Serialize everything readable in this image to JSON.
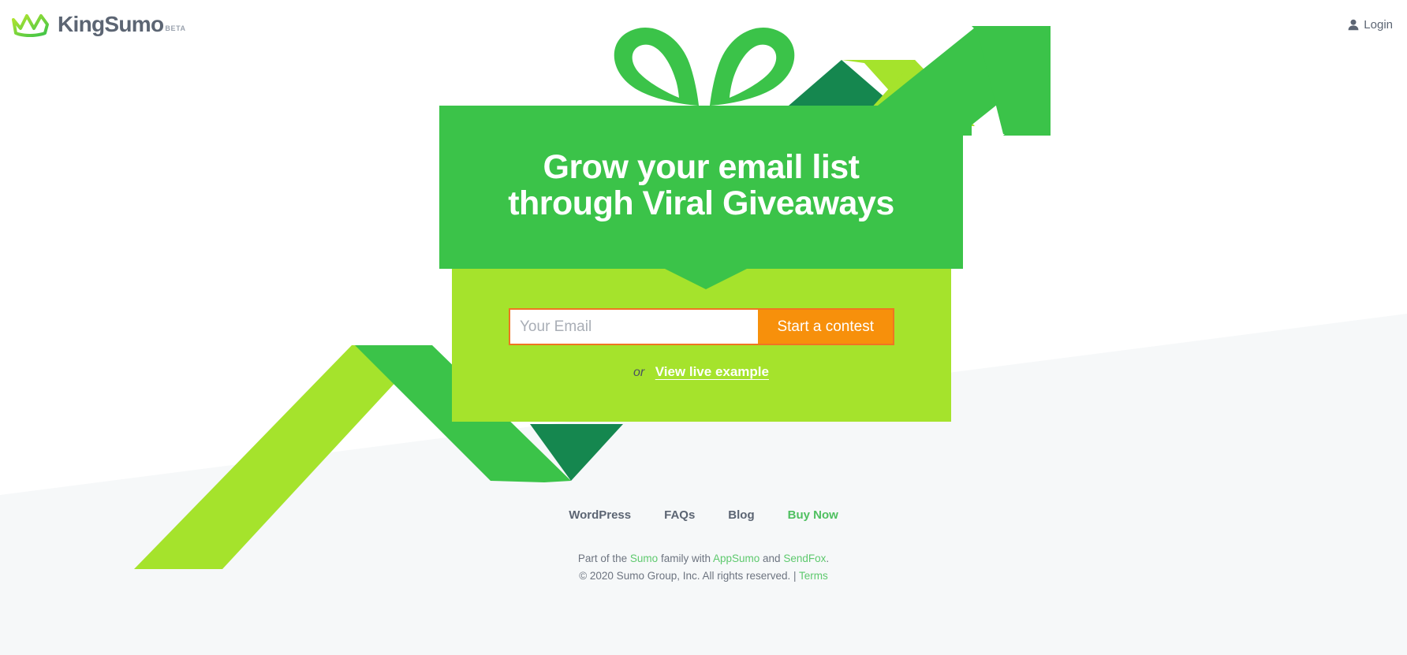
{
  "brand": {
    "name_king": "King",
    "name_sumo": "Sumo",
    "badge": "BETA",
    "crown_icon": "crown-icon",
    "crown_color_light": "#a5e32c",
    "crown_color_dark": "#3bc349"
  },
  "header": {
    "login_label": "Login",
    "login_icon": "user-icon"
  },
  "hero": {
    "headline_line1": "Grow your email list",
    "headline_line2": "through Viral Giveaways",
    "panel_color": "#3bc349",
    "panel_lime_color": "#a5e32c"
  },
  "form": {
    "email_placeholder": "Your Email",
    "email_value": "",
    "submit_label": "Start a contest",
    "submit_color": "#f7900b",
    "border_color": "#ef7522",
    "or_label": "or",
    "example_link_label": "View live example"
  },
  "footer": {
    "nav": [
      {
        "label": "WordPress",
        "accent": false
      },
      {
        "label": "FAQs",
        "accent": false
      },
      {
        "label": "Blog",
        "accent": false
      },
      {
        "label": "Buy Now",
        "accent": true
      }
    ],
    "family_prefix": "Part of the ",
    "family_sumo": "Sumo",
    "family_mid": " family with ",
    "family_appsumo": "AppSumo",
    "family_and": " and ",
    "family_sendfox": "SendFox",
    "family_suffix": ".",
    "copyright": "© 2020 Sumo Group, Inc. All rights reserved. | ",
    "terms_label": "Terms",
    "link_color": "#5ec96e"
  },
  "decor": {
    "gift_bow_icon": "gift-bow-icon",
    "arrow_up_icon": "trend-arrow-icon",
    "ribbon_icon": "zigzag-ribbon-icon",
    "band_color": "#f6f8f9",
    "green_mid": "#3bc349",
    "green_dark": "#15874f",
    "green_lime": "#a5e32c"
  }
}
